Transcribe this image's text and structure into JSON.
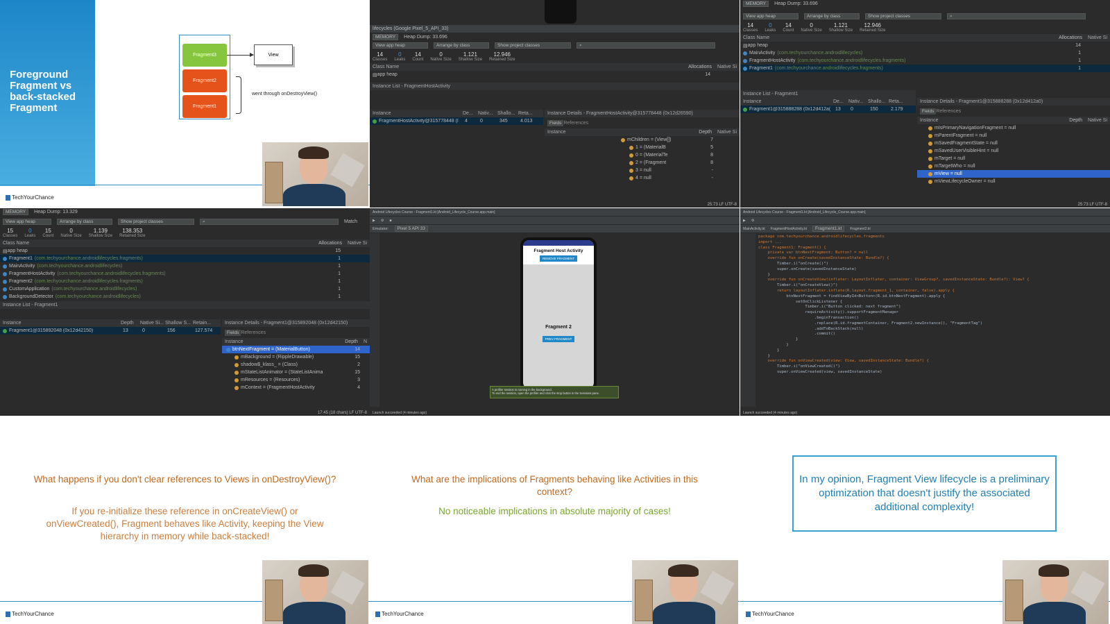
{
  "slide_lifecycle": {
    "title": "Foreground Fragment vs back-stacked Fragment",
    "fragments": [
      "Fragment3",
      "Fragment2",
      "Fragment1"
    ],
    "view_label": "View",
    "destroy_label": "went through onDestroyView()",
    "brand": "TechYourChance"
  },
  "profiler_top_middle": {
    "device": "lifecycles (Google Pixel_5_API_33)",
    "memory": "MEMORY",
    "heap_dump": "Heap Dump: 33.696",
    "view_app_heap": "View app heap",
    "arrange": "Arrange by class",
    "show": "Show project classes",
    "stats": [
      {
        "v": "14",
        "l": "Classes"
      },
      {
        "v": "0",
        "l": "Leaks"
      },
      {
        "v": "14",
        "l": "Count"
      },
      {
        "v": "0",
        "l": "Native Size"
      },
      {
        "v": "1.121",
        "l": "Shallow Size"
      },
      {
        "v": "12.946",
        "l": "Retained Size"
      }
    ],
    "class_name_header": "Class Name",
    "allocations_header": "Allocations",
    "native_header": "Native Si",
    "app_heap": "app heap",
    "app_heap_count": "14",
    "instance_list_title": "Instance List - FragmentHostActivity",
    "instance_cols": [
      "Instance",
      "De...",
      "Nativ...",
      "Shallo...",
      "Reta..."
    ],
    "instance_row": [
      "FragmentHostActivity@315778448 (I",
      "4",
      "0",
      "345",
      "4.013"
    ],
    "details_title": "Instance Details - FragmentHostActivity@315778448 (0x12d26590)",
    "tabs": [
      "Fields",
      "References"
    ],
    "details_cols": [
      "Instance",
      "Depth",
      "Native Si"
    ],
    "details_rows": [
      {
        "label": "mChildren = (View[])",
        "depth": "7"
      },
      {
        "label": "1 = (MaterialB",
        "depth": "5"
      },
      {
        "label": "0 = (MaterialTe",
        "depth": "8"
      },
      {
        "label": "2 = (Fragment",
        "depth": "8"
      },
      {
        "label": "3 = null",
        "depth": "-"
      },
      {
        "label": "4 = null",
        "depth": "-"
      }
    ],
    "status": "25:73  LF  UTF-8"
  },
  "profiler_top_right": {
    "memory": "MEMORY",
    "heap_dump": "Heap Dump: 33.696",
    "view_app_heap": "View app heap",
    "arrange": "Arrange by class",
    "show": "Show project classes",
    "stats": [
      {
        "v": "14",
        "l": "Classes"
      },
      {
        "v": "0",
        "l": "Leaks"
      },
      {
        "v": "14",
        "l": "Count"
      },
      {
        "v": "0",
        "l": "Native Size"
      },
      {
        "v": "1.121",
        "l": "Shallow Size"
      },
      {
        "v": "12.946",
        "l": "Retained Size"
      }
    ],
    "class_name_header": "Class Name",
    "allocations_header": "Allocations",
    "native_header": "Native Si",
    "classes": [
      {
        "name": "app heap",
        "pkg": "",
        "count": "14"
      },
      {
        "name": "MainActivity",
        "pkg": "(com.techyourchance.androidlifecycles)",
        "count": "1"
      },
      {
        "name": "FragmentHostActivity",
        "pkg": "(com.techyourchance.androidlifecycles.fragments)",
        "count": "1"
      },
      {
        "name": "Fragment1",
        "pkg": "(com.techyourchance.androidlifecycles.fragments)",
        "count": "1"
      }
    ],
    "instance_list_title": "Instance List - Fragment1",
    "instance_cols": [
      "Instance",
      "De...",
      "Nativ...",
      "Shallo...",
      "Reta..."
    ],
    "instance_row": [
      "Fragment1@315888288 (0x12d412a(",
      "13",
      "0",
      "150",
      "2.179"
    ],
    "details_title": "Instance Details - Fragment1@315888288 (0x12d412a0)",
    "tabs": [
      "Fields",
      "References"
    ],
    "details_cols": [
      "Instance",
      "Depth",
      "Native Si"
    ],
    "details_rows": [
      "mIsPrimaryNavigationFragment = null",
      "mParentFragment = null",
      "mSavedFragmentState = null",
      "mSavedUserVisibleHint = null",
      "mTarget = null",
      "mTargetWho = null",
      "mView = null",
      "mViewLifecycleOwner = null"
    ],
    "status": "25:73  LF  UTF-8"
  },
  "profiler_mid_left": {
    "memory": "MEMORY",
    "heap_dump": "Heap Dump: 13.329",
    "view_app_heap": "View app heap",
    "arrange": "Arrange by class",
    "show": "Show project classes",
    "match": "Match",
    "stats": [
      {
        "v": "15",
        "l": "Classes"
      },
      {
        "v": "0",
        "l": "Leaks"
      },
      {
        "v": "15",
        "l": "Count"
      },
      {
        "v": "0",
        "l": "Native Size"
      },
      {
        "v": "1.139",
        "l": "Shallow Size"
      },
      {
        "v": "138.353",
        "l": "Retained Size"
      }
    ],
    "class_name_header": "Class Name",
    "allocations_header": "Allocations",
    "native_header": "Native Si",
    "classes": [
      {
        "name": "app heap",
        "pkg": "",
        "count": "15"
      },
      {
        "name": "Fragment1",
        "pkg": "(com.techyourchance.androidlifecycles.fragments)",
        "count": "1"
      },
      {
        "name": "MainActivity",
        "pkg": "(com.techyourchance.androidlifecycles)",
        "count": "1"
      },
      {
        "name": "FragmentHostActivity",
        "pkg": "(com.techyourchance.androidlifecycles.fragments)",
        "count": "1"
      },
      {
        "name": "Fragment2",
        "pkg": "(com.techyourchance.androidlifecycles.fragments)",
        "count": "1"
      },
      {
        "name": "CustomApplication",
        "pkg": "(com.techyourchance.androidlifecycles)",
        "count": "1"
      },
      {
        "name": "BackgroundDetector",
        "pkg": "(com.techyourchance.androidlifecycles)",
        "count": "1"
      }
    ],
    "instance_list_title": "Instance List - Fragment1",
    "instance_cols": [
      "Instance",
      "Depth",
      "Native Si...",
      "Shallow S...",
      "Retain..."
    ],
    "instance_row": [
      "Fragment1@315892048 (0x12d42150)",
      "13",
      "0",
      "156",
      "127.574"
    ],
    "details_title": "Instance Details - Fragment1@315892048 (0x12d42150)",
    "tabs": [
      "Fields",
      "References"
    ],
    "details_cols": [
      "Instance",
      "Depth",
      "N"
    ],
    "details_rows": [
      {
        "label": "btnNextFragment = (MaterialButton)",
        "depth": "14"
      },
      {
        "label": "mBackground = (RippleDrawable)",
        "depth": "15"
      },
      {
        "label": "shadow$_klass_ = (Class)",
        "depth": "2"
      },
      {
        "label": "mStateListAnimator = (StateListAnima",
        "depth": "15"
      },
      {
        "label": "mResources = (Resources)",
        "depth": "3"
      },
      {
        "label": "mContext = (FragmentHostActivity",
        "depth": "4"
      }
    ],
    "status": "17:45 (18 chars)  LF  UTF-8"
  },
  "emulator_mid": {
    "title": "Android Lifecycles Course - Fragment1.kt [Android_Lifecycle_Course.app.main]",
    "emulator_tab": "Emulator:",
    "device": "Pixel 5 API 33",
    "app_title": "Fragment Host Activity",
    "remove_btn": "REMOVE FRAGMENT",
    "fragment_label": "Fragment 2",
    "prev_btn": "PREV FRAGMENT",
    "toast_line1": "A profiler session is running in the background.",
    "toast_line2": "To end the session, open the profiler and click the stop button in the Sessions pane.",
    "status": "Launch succeeded (4 minutes ago)"
  },
  "code_mid_right": {
    "title": "Android Lifecycles Course - Fragment1.kt [Android_Lifecycle_Course.app.main]",
    "tabs": [
      "MainActivity.kt",
      "FragmentHostActivity.kt",
      "Fragment1.kt",
      "Fragment2.kt"
    ],
    "lines": [
      "package com.techyourchance.androidlifecycles.fragments",
      "",
      "import ...",
      "",
      "class Fragment1: Fragment() {",
      "",
      "    private var btnNextFragment: Button? = null",
      "",
      "    override fun onCreate(savedInstanceState: Bundle?) {",
      "        Timber.i(\"onCreate()\")",
      "        super.onCreate(savedInstanceState)",
      "    }",
      "",
      "    override fun onCreateView(inflater: LayoutInflater, container: ViewGroup?, savedInstanceState: Bundle?): View? {",
      "        Timber.i(\"onCreateView()\")",
      "        return layoutInflater.inflate(R.layout.fragment_1, container, false).apply {",
      "            btnNextFragment = findViewById<Button>(R.id.btnNextFragment).apply {",
      "                setOnClickListener {",
      "                    Timber.i(\"Button clicked: next fragment\")",
      "                    requireActivity().supportFragmentManager",
      "                        .beginTransaction()",
      "                        .replace(R.id.fragmentContainer, Fragment2.newInstance(), \"FragmentTag\")",
      "                        .addToBackStack(null)",
      "                        .commit()",
      "                }",
      "            }",
      "        }",
      "    }",
      "",
      "    override fun onViewCreated(view: View, savedInstanceState: Bundle?) {",
      "        Timber.i(\"onViewCreated()\")",
      "        super.onViewCreated(view, savedInstanceState)"
    ],
    "status": "Launch succeeded (4 minutes ago)"
  },
  "slide_q1": {
    "question": "What happens if you don't clear references to Views in onDestroyView()?",
    "answer": "If you re-initialize these reference in onCreateView() or onViewCreated(), Fragment behaves like Activity, keeping the View hierarchy in memory while back-stacked!",
    "brand": "TechYourChance"
  },
  "slide_q2": {
    "question": "What are the implications of Fragments behaving like Activities in this context?",
    "answer": "No noticeable implications in absolute majority of cases!",
    "brand": "TechYourChance"
  },
  "slide_opinion": {
    "text": "In my opinion, Fragment View lifecycle is a preliminary optimization that doesn't justify the associated additional complexity!",
    "brand": "TechYourChance"
  }
}
